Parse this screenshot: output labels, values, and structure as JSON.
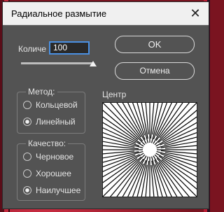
{
  "dialog": {
    "title": "Радиальное размытие",
    "close_glyph": "✕"
  },
  "amount": {
    "label": "Количе",
    "value": "100",
    "slider_fraction": 1.0
  },
  "buttons": {
    "ok": "OK",
    "cancel": "Отмена"
  },
  "method": {
    "legend": "Метод:",
    "options": [
      "Кольцевой",
      "Линейный"
    ],
    "selected": "Линейный"
  },
  "quality": {
    "legend": "Качество:",
    "options": [
      "Черновое",
      "Хорошее",
      "Наилучшее"
    ],
    "selected": "Наилучшее"
  },
  "center": {
    "label": "Центр"
  }
}
